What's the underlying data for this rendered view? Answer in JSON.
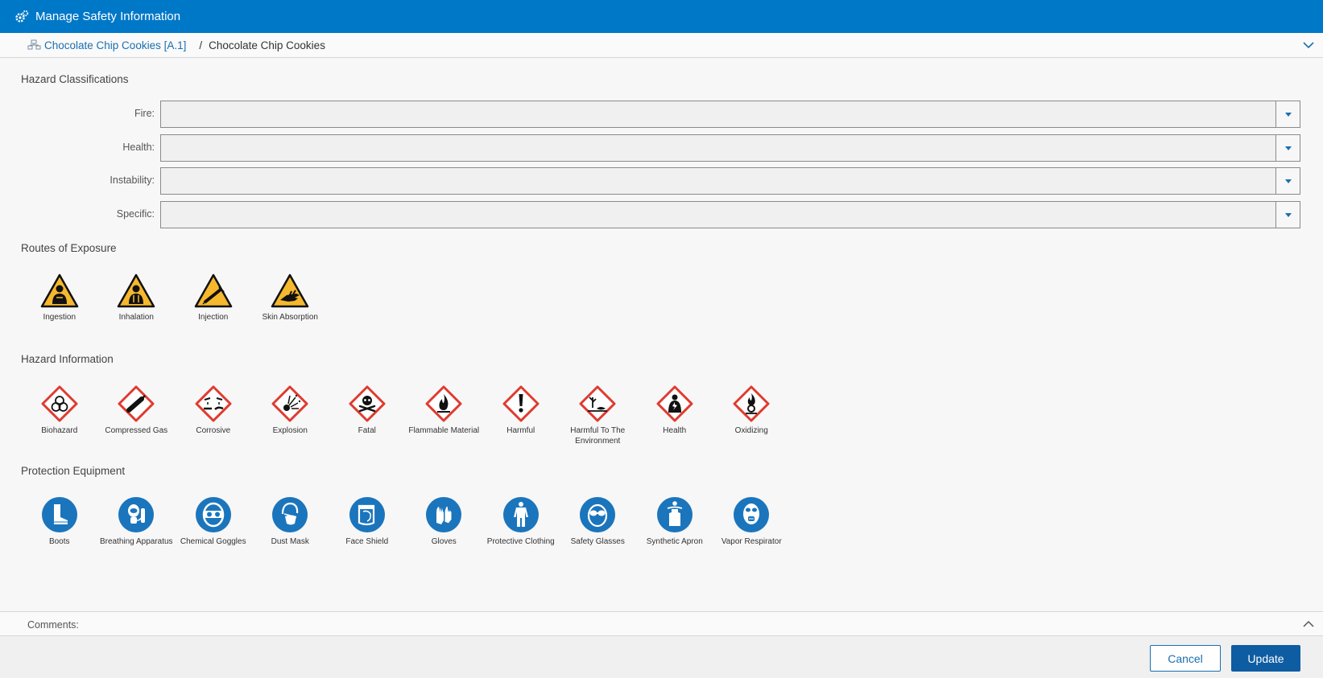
{
  "titlebar": {
    "title": "Manage Safety Information"
  },
  "breadcrumb": {
    "link": "Chocolate Chip Cookies [A.1]",
    "separator": "/",
    "current": "Chocolate Chip Cookies"
  },
  "sections": {
    "hazard_classifications": "Hazard Classifications",
    "routes_of_exposure": "Routes of Exposure",
    "hazard_information": "Hazard Information",
    "protection_equipment": "Protection Equipment"
  },
  "fields": [
    {
      "label": "Fire:",
      "value": ""
    },
    {
      "label": "Health:",
      "value": ""
    },
    {
      "label": "Instability:",
      "value": ""
    },
    {
      "label": "Specific:",
      "value": ""
    }
  ],
  "routes": [
    {
      "label": "Ingestion",
      "icon": "ingestion-icon"
    },
    {
      "label": "Inhalation",
      "icon": "inhalation-icon"
    },
    {
      "label": "Injection",
      "icon": "injection-icon"
    },
    {
      "label": "Skin Absorption",
      "icon": "skin-absorption-icon"
    }
  ],
  "hazards": [
    {
      "label": "Biohazard",
      "icon": "biohazard-icon"
    },
    {
      "label": "Compressed Gas",
      "icon": "compressed-gas-icon"
    },
    {
      "label": "Corrosive",
      "icon": "corrosive-icon"
    },
    {
      "label": "Explosion",
      "icon": "explosion-icon"
    },
    {
      "label": "Fatal",
      "icon": "fatal-icon"
    },
    {
      "label": "Flammable Material",
      "icon": "flammable-icon"
    },
    {
      "label": "Harmful",
      "icon": "harmful-icon"
    },
    {
      "label": "Harmful To The Environment",
      "icon": "environment-icon"
    },
    {
      "label": "Health",
      "icon": "health-hazard-icon"
    },
    {
      "label": "Oxidizing",
      "icon": "oxidizing-icon"
    }
  ],
  "equipment": [
    {
      "label": "Boots",
      "icon": "boots-icon"
    },
    {
      "label": "Breathing Apparatus",
      "icon": "breathing-apparatus-icon"
    },
    {
      "label": "Chemical Goggles",
      "icon": "chemical-goggles-icon"
    },
    {
      "label": "Dust Mask",
      "icon": "dust-mask-icon"
    },
    {
      "label": "Face Shield",
      "icon": "face-shield-icon"
    },
    {
      "label": "Gloves",
      "icon": "gloves-icon"
    },
    {
      "label": "Protective Clothing",
      "icon": "protective-clothing-icon"
    },
    {
      "label": "Safety Glasses",
      "icon": "safety-glasses-icon"
    },
    {
      "label": "Synthetic Apron",
      "icon": "synthetic-apron-icon"
    },
    {
      "label": "Vapor Respirator",
      "icon": "vapor-respirator-icon"
    }
  ],
  "comments": {
    "label": "Comments:"
  },
  "footer": {
    "cancel": "Cancel",
    "update": "Update"
  },
  "colors": {
    "header_blue": "#0078c8",
    "link_blue": "#1a6fb0",
    "warning_yellow": "#f5b82e",
    "hazard_red": "#e03a2f",
    "ppe_blue": "#1b75bc",
    "primary_button": "#0e5da3"
  }
}
